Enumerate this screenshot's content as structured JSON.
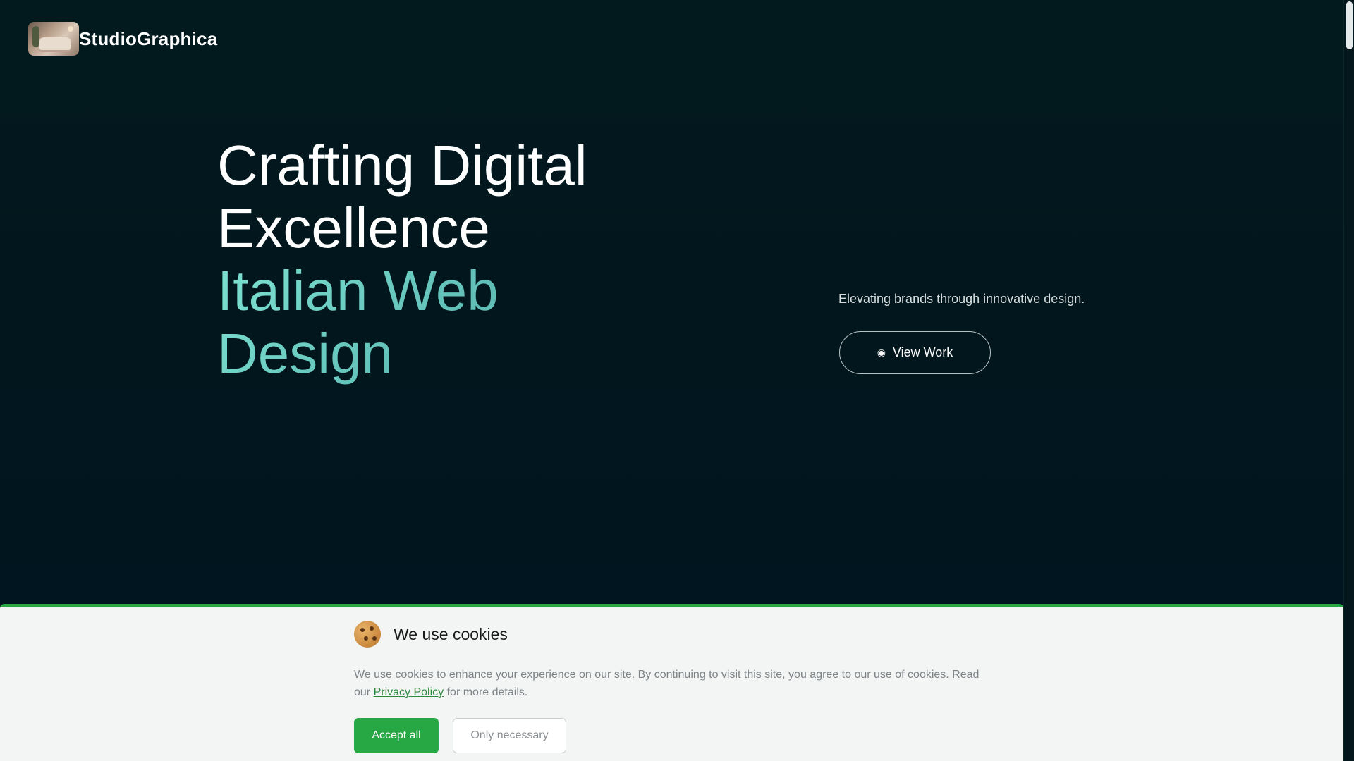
{
  "header": {
    "brand": "StudioGraphica"
  },
  "hero": {
    "title_line1": "Crafting Digital Excellence",
    "title_line2": "Italian Web Design",
    "tagline": "Elevating brands through innovative design.",
    "cta_label": "View Work",
    "cta_icon": "eye-icon"
  },
  "cookie_banner": {
    "title": "We use cookies",
    "text_before_link": "We use cookies to enhance your experience on our site. By continuing to visit this site, you agree to our use of cookies. Read our ",
    "link_label": "Privacy Policy",
    "text_after_link": " for more details.",
    "accept_label": "Accept all",
    "necessary_label": "Only necessary"
  },
  "colors": {
    "background": "#01161d",
    "accent_green": "#28a745",
    "gradient_teal": "#7ee3d2"
  }
}
